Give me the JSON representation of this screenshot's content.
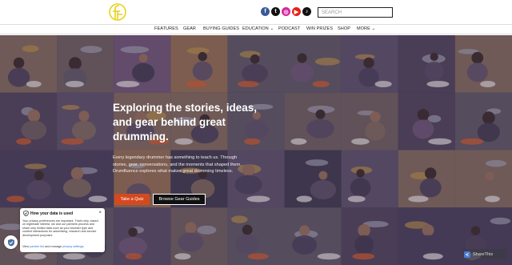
{
  "header": {
    "logo_name": "drumfluence-logo",
    "social": [
      {
        "name": "facebook-icon",
        "glyph": "f",
        "color": "#3b5998"
      },
      {
        "name": "twitter-icon",
        "glyph": "t",
        "color": "#111111"
      },
      {
        "name": "instagram-icon",
        "glyph": "◎",
        "color": "#d6249f"
      },
      {
        "name": "youtube-icon",
        "glyph": "▶",
        "color": "#e62117"
      },
      {
        "name": "tiktok-icon",
        "glyph": "♪",
        "color": "#111111"
      }
    ],
    "search_placeholder": "SEARCH"
  },
  "nav": {
    "items": [
      {
        "label": "FEATURES"
      },
      {
        "label": "GEAR"
      },
      {
        "label": "BUYING GUIDES"
      },
      {
        "label": "EDUCATION",
        "dropdown": true
      },
      {
        "label": "PODCAST"
      },
      {
        "label": "WIN PRIZES"
      },
      {
        "label": "SHOP"
      },
      {
        "label": "MORE",
        "dropdown": true
      }
    ]
  },
  "hero": {
    "headline": "Exploring the stories, ideas, and gear behind great drumming.",
    "subtext": "Every legendary drummer has something to teach us. Through stories, gear, conversations, and the moments that shaped them, Drumfluence explores what makes great drumming timeless.",
    "primary_button": "Take a Quiz",
    "secondary_button": "Browse Gear Guides"
  },
  "cookie_notice": {
    "title": "How your data is used",
    "body": "Your privacy preferences are important. That's why, based on legitimate interest, we and our partners process and share only limited data such as your browser type and content interactions for advertising, research and service development purposes.",
    "links_prefix": "View",
    "partner_link": "partner list",
    "links_middle": "and manage",
    "settings_link": "privacy settings",
    "links_suffix": ".",
    "close": "×"
  },
  "watermark": {
    "text": "ShareThis"
  },
  "colors": {
    "accent": "#d5491f",
    "logo_yellow": "#e8d21a"
  }
}
